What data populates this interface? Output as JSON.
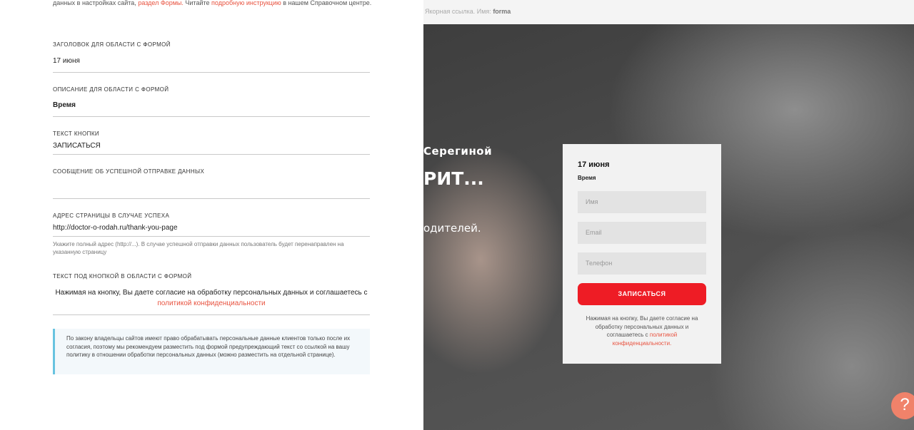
{
  "intro": {
    "prefix": "данных в настройках сайта,",
    "link1": "раздел Формы.",
    "middle": "Читайте",
    "link2": "подробную инструкцию",
    "suffix": "в нашем Справочном центре."
  },
  "fields": {
    "title_label": "Заголовок для области с формой",
    "title_value": "17 июня",
    "desc_label": "Описание для области с формой",
    "desc_value": "Время",
    "button_label": "Текст кнопки",
    "button_value": "ЗАПИСАТЬСЯ",
    "success_label": "Сообщение об успешной отправке данных",
    "success_value": "",
    "redirect_label": "Адрес страницы в случае успеха",
    "redirect_value": "http://doctor-o-rodah.ru/thank-you-page",
    "redirect_hint": "Укажите полный адрес (http://...). В случае успешной отправки данных пользователь будет перенаправлен на указанную страницу",
    "consent_label": "Текст под кнопкой в области с формой",
    "consent_text": "Нажимая на кнопку, Вы даете согласие на обработку персональных данных и соглашаетесь с",
    "consent_link": "политикой конфиденциальности"
  },
  "note": "По закону владельцы сайтов имеют право обрабатывать персональные данные клиентов только после их согласия, поэтому мы рекомендуем разместить под формой предупреждающий текст со ссылкой на вашу политику в отношении обработки персональных данных (можно разместить на отдельной странице).",
  "preview": {
    "anchor_label": "Якорная ссылка. Имя:",
    "anchor_name": "forma",
    "hero_line1": "Серегиной",
    "hero_line2": "РИТ...",
    "hero_line3": "одителей.",
    "form": {
      "title": "17 июня",
      "desc": "Время",
      "name_placeholder": "Имя",
      "email_placeholder": "Email",
      "phone_placeholder": "Телефон",
      "submit": "ЗАПИСАТЬСЯ",
      "consent_text": "Нажимая на кнопку, Вы даете согласие на обработку персональных данных и соглашаетесь с",
      "consent_link": "политикой конфиденциальности."
    }
  },
  "help_icon": "?"
}
